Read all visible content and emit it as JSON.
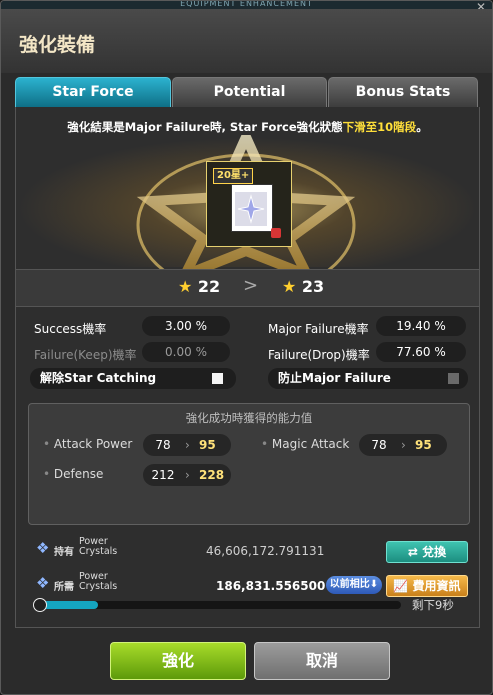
{
  "window": {
    "topbar_title": "EQUIPMENT ENHANCEMENT",
    "close_symbol": "✕",
    "title": "強化裝備"
  },
  "tabs": [
    {
      "label": "Star Force",
      "active": true
    },
    {
      "label": "Potential",
      "active": false
    },
    {
      "label": "Bonus Stats",
      "active": false
    }
  ],
  "notice": {
    "prefix": "強化結果是Major Failure時, Star Force強化狀態",
    "highlight": "下滑至10階段",
    "suffix": "。"
  },
  "item": {
    "badge": "20星+"
  },
  "levels": {
    "current": "22",
    "next": "23",
    "arrow": ">"
  },
  "rates": {
    "success": {
      "label": "Success機率",
      "value": "3.00 %"
    },
    "failure_keep": {
      "label": "Failure(Keep)機率",
      "value": "0.00 %"
    },
    "major_failure": {
      "label": "Major Failure機率",
      "value": "19.40 %"
    },
    "failure_drop": {
      "label": "Failure(Drop)機率",
      "value": "77.60 %"
    }
  },
  "options": {
    "star_catching": {
      "label": "解除Star Catching",
      "checked": false
    },
    "prevent_major_failure": {
      "label": "防止Major Failure",
      "checked": false
    }
  },
  "stats": {
    "title": "強化成功時獲得的能力值",
    "attack_power": {
      "label": "Attack Power",
      "from": "78",
      "to": "95"
    },
    "magic_attack": {
      "label": "Magic Attack",
      "from": "78",
      "to": "95"
    },
    "defense": {
      "label": "Defense",
      "from": "212",
      "to": "228"
    }
  },
  "crystals": {
    "owned": {
      "label": "持有",
      "sub1": "Power",
      "sub2": "Crystals",
      "value": "46,606,172.791131"
    },
    "required": {
      "label": "所需",
      "sub1": "Power",
      "sub2": "Crystals",
      "value": "186,831.556500"
    },
    "exchange_label": "兌換",
    "compare_label": "以前相比",
    "cost_info_label": "費用資訊"
  },
  "timer": {
    "progress": 0.17,
    "remaining_label": "剩下9秒"
  },
  "buttons": {
    "enhance": "強化",
    "cancel": "取消"
  },
  "colors": {
    "accent_tab": "#1f8fa8",
    "highlight": "#ffdf3a",
    "enhance_green": "#7fbe1a"
  }
}
